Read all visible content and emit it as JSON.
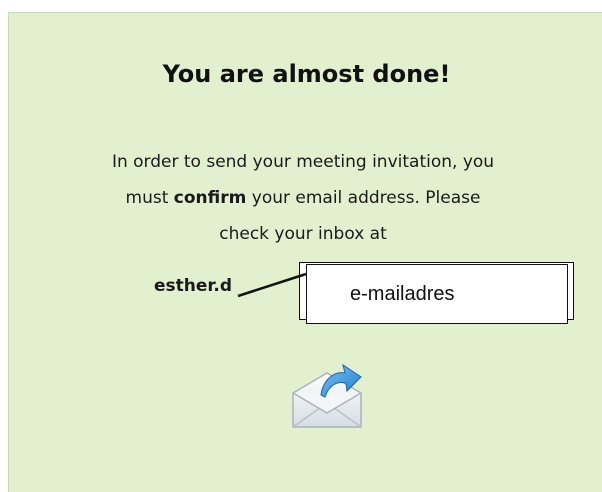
{
  "dialog": {
    "title": "You are almost done!",
    "message_line1": "In order to send your meeting invitation, you",
    "message_line2_pre": "must ",
    "message_line2_bold": "confirm",
    "message_line2_post": " your email address. Please",
    "message_line3": "check your inbox at",
    "email_partial": "esther.d"
  },
  "callout": {
    "text": "e-mailadres"
  },
  "icons": {
    "mail": "envelope-with-arrow-icon"
  },
  "colors": {
    "panel_background": "#e3f0cf",
    "icon_arrow_blue": "#2a8fd8"
  }
}
